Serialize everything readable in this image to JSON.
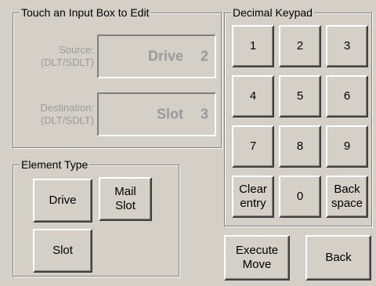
{
  "edit_group": {
    "title": "Touch an Input Box to Edit",
    "source": {
      "label": "Source:\n(DLT/SDLT)",
      "value": "Drive",
      "number": "2"
    },
    "destination": {
      "label": "Destination:\n(DLT/SDLT)",
      "value": "Slot",
      "number": "3"
    }
  },
  "element_type": {
    "title": "Element Type",
    "drive": "Drive",
    "mail_slot": "Mail\nSlot",
    "slot": "Slot"
  },
  "keypad": {
    "title": "Decimal Keypad",
    "keys": [
      "1",
      "2",
      "3",
      "4",
      "5",
      "6",
      "7",
      "8",
      "9"
    ],
    "clear": "Clear\nentry",
    "zero": "0",
    "backspace": "Back\nspace"
  },
  "actions": {
    "execute": "Execute\nMove",
    "back": "Back"
  }
}
